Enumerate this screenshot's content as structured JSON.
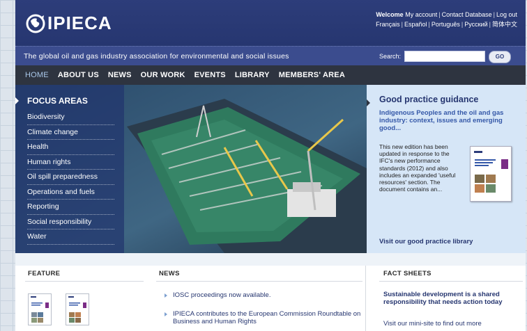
{
  "header": {
    "logo_text": "IPIECA",
    "welcome": "Welcome",
    "account_links": [
      "My account",
      "Contact Database",
      "Log out"
    ],
    "language_links": [
      "Français",
      "Español",
      "Português",
      "Русский",
      "简体中文"
    ]
  },
  "tagbar": {
    "tagline": "The global oil and gas industry association for environmental and social issues",
    "search_label": "Search:",
    "search_value": "",
    "go_label": "GO"
  },
  "nav": {
    "items": [
      "HOME",
      "ABOUT US",
      "NEWS",
      "OUR WORK",
      "EVENTS",
      "LIBRARY",
      "MEMBERS' AREA"
    ]
  },
  "focus": {
    "title": "FOCUS AREAS",
    "items": [
      "Biodiversity",
      "Climate change",
      "Health",
      "Human rights",
      "Oil spill preparedness",
      "Operations and fuels",
      "Reporting",
      "Social responsibility",
      "Water"
    ]
  },
  "good_practice": {
    "title": "Good practice guidance",
    "subtitle": "Indigenous Peoples and the oil and gas industry: context, issues and emerging good...",
    "body": "This new edition has been updated in response to the IFC's new performance standards (2012) and also includes an expanded 'useful resources' section. The document contains an...",
    "link": "Visit our good practice library"
  },
  "bottom": {
    "feature_title": "FEATURE",
    "news_title": "NEWS",
    "facts_title": "FACT SHEETS",
    "news_items": [
      "IOSC proceedings now available.",
      "IPIECA contributes to the European Commission Roundtable on Business and Human Rights"
    ],
    "fact_text": "Sustainable development is a shared responsibility that needs action today",
    "fact_link": "Visit our mini-site to find out more"
  },
  "colors": {
    "header": "#2d3d7a",
    "nav": "#2e3440",
    "focus_panel": "#21356e",
    "panel_light": "#d6e6f7",
    "link": "#263670"
  }
}
